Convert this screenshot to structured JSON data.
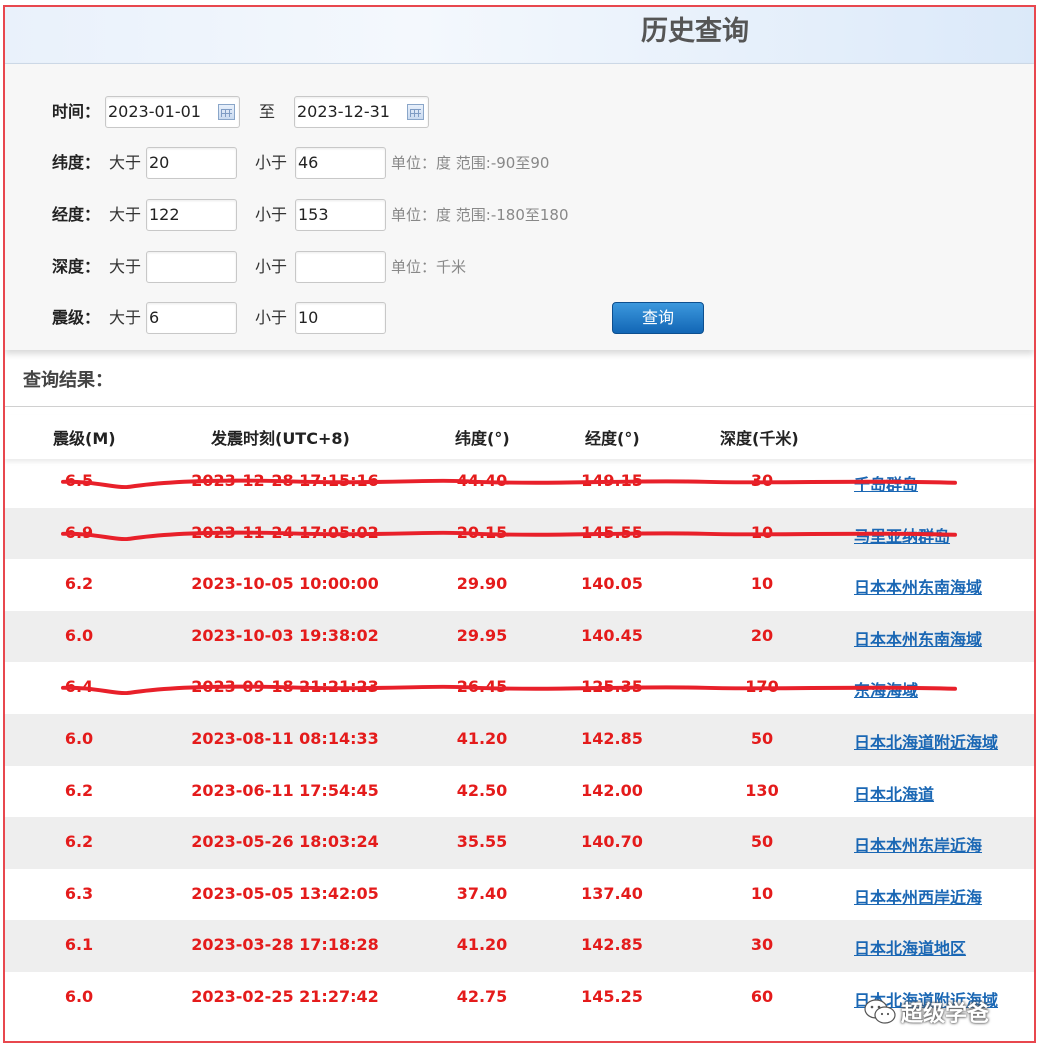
{
  "header": {
    "title": "历史查询"
  },
  "form": {
    "time_label": "时间：",
    "time_from": "2023-01-01",
    "to_label": "至",
    "time_to": "2023-12-31",
    "lat_label": "纬度：",
    "lon_label": "经度：",
    "depth_label": "深度：",
    "mag_label": "震级：",
    "gt": "大于",
    "lt": "小于",
    "lat_min": "20",
    "lat_max": "46",
    "lat_hint": "单位：度 范围:-90至90",
    "lon_min": "122",
    "lon_max": "153",
    "lon_hint": "单位：度 范围:-180至180",
    "depth_min": "",
    "depth_max": "",
    "depth_hint": "单位：千米",
    "mag_min": "6",
    "mag_max": "10",
    "search_button": "查询"
  },
  "results": {
    "label": "查询结果：",
    "columns": [
      "震级(M)",
      "发震时刻(UTC+8)",
      "纬度(°)",
      "经度(°)",
      "深度(千米)"
    ],
    "rows": [
      {
        "mag": "6.5",
        "time": "2023-12-28 17:15:16",
        "lat": "44.40",
        "lon": "149.15",
        "depth": "30",
        "loc": "千岛群岛",
        "struck": true
      },
      {
        "mag": "6.9",
        "time": "2023-11-24 17:05:02",
        "lat": "20.15",
        "lon": "145.55",
        "depth": "10",
        "loc": "马里亚纳群岛",
        "struck": true
      },
      {
        "mag": "6.2",
        "time": "2023-10-05 10:00:00",
        "lat": "29.90",
        "lon": "140.05",
        "depth": "10",
        "loc": "日本本州东南海域",
        "struck": false
      },
      {
        "mag": "6.0",
        "time": "2023-10-03 19:38:02",
        "lat": "29.95",
        "lon": "140.45",
        "depth": "20",
        "loc": "日本本州东南海域",
        "struck": false
      },
      {
        "mag": "6.4",
        "time": "2023-09-18 21:21:23",
        "lat": "26.45",
        "lon": "125.35",
        "depth": "170",
        "loc": "东海海域",
        "struck": true
      },
      {
        "mag": "6.0",
        "time": "2023-08-11 08:14:33",
        "lat": "41.20",
        "lon": "142.85",
        "depth": "50",
        "loc": "日本北海道附近海域",
        "struck": false
      },
      {
        "mag": "6.2",
        "time": "2023-06-11 17:54:45",
        "lat": "42.50",
        "lon": "142.00",
        "depth": "130",
        "loc": "日本北海道",
        "struck": false
      },
      {
        "mag": "6.2",
        "time": "2023-05-26 18:03:24",
        "lat": "35.55",
        "lon": "140.70",
        "depth": "50",
        "loc": "日本本州东岸近海",
        "struck": false
      },
      {
        "mag": "6.3",
        "time": "2023-05-05 13:42:05",
        "lat": "37.40",
        "lon": "137.40",
        "depth": "10",
        "loc": "日本本州西岸近海",
        "struck": false
      },
      {
        "mag": "6.1",
        "time": "2023-03-28 17:18:28",
        "lat": "41.20",
        "lon": "142.85",
        "depth": "30",
        "loc": "日本北海道地区",
        "struck": false
      },
      {
        "mag": "6.0",
        "time": "2023-02-25 21:27:42",
        "lat": "42.75",
        "lon": "145.25",
        "depth": "60",
        "loc": "日本北海道附近海域",
        "struck": false
      }
    ]
  },
  "watermark": {
    "text": "超级学爸",
    "icon": "wechat-icon"
  },
  "colors": {
    "value_red": "#e41b1b",
    "link_blue": "#1a67b4",
    "strike_red": "#e8202a",
    "button_blue": "#1a73c4"
  }
}
